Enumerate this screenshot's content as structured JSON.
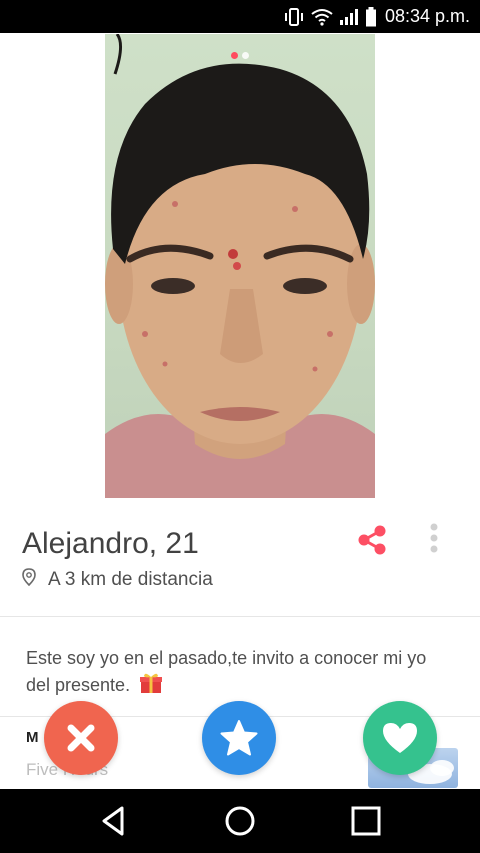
{
  "status_bar": {
    "time": "08:34 p.m.",
    "icons": [
      "vibrate-icon",
      "wifi-icon",
      "signal-icon",
      "battery-icon"
    ]
  },
  "photo": {
    "page_count": 2,
    "active_page": 1
  },
  "profile": {
    "name": "Alejandro, 21",
    "distance": "A 3 km de distancia",
    "bio": "Este soy yo en el pasado,te invito a conocer mi yo del presente.",
    "bio_emoji": "gift-icon"
  },
  "next_section": {
    "title": "M",
    "subtitle": "Five Hours"
  },
  "actions": {
    "nope": "close-icon",
    "superlike": "star-icon",
    "like": "heart-icon"
  },
  "nav": [
    "back-icon",
    "home-icon",
    "recents-icon"
  ],
  "colors": {
    "accent": "#ff4a5f",
    "nope": "#f0654f",
    "superlike": "#2f8ee6",
    "like": "#35c28e"
  }
}
